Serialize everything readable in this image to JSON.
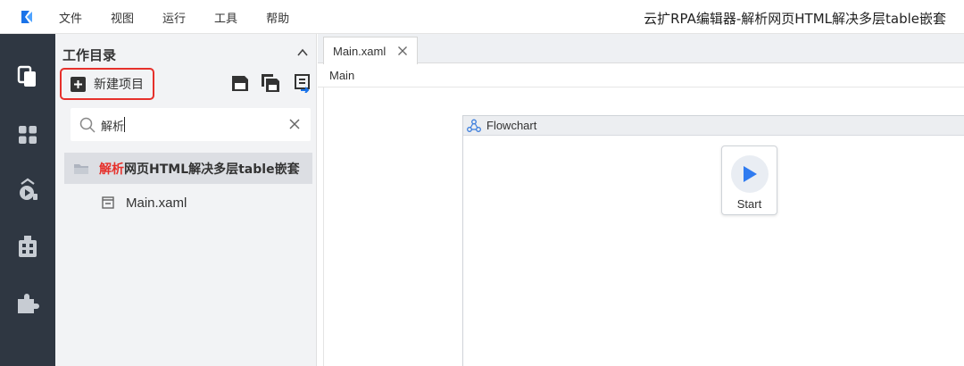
{
  "app": {
    "window_title": "云扩RPA编辑器-解析网页HTML解决多层table嵌套",
    "brand_color": "#1a73e8"
  },
  "menu": {
    "items": [
      {
        "label": "文件"
      },
      {
        "label": "视图"
      },
      {
        "label": "运行"
      },
      {
        "label": "工具"
      },
      {
        "label": "帮助"
      }
    ]
  },
  "rail": {
    "icons": [
      "copy-icon",
      "dashboard-icon",
      "robot-run-icon",
      "building-icon",
      "puzzle-icon"
    ]
  },
  "explorer": {
    "title": "工作目录",
    "new_project_label": "新建项目",
    "toolbar_icons": [
      "save-icon",
      "save-all-icon",
      "export-icon"
    ],
    "search": {
      "value": "解析",
      "placeholder": ""
    },
    "project": {
      "name_highlight": "解析",
      "name_rest": "网页HTML解决多层table嵌套"
    },
    "files": [
      {
        "name": "Main.xaml"
      }
    ],
    "highlight_color": "#e6302b"
  },
  "editor": {
    "tabs": [
      {
        "label": "Main.xaml"
      }
    ],
    "breadcrumb": "Main",
    "flowchart": {
      "title": "Flowchart",
      "start_label": "Start"
    }
  }
}
